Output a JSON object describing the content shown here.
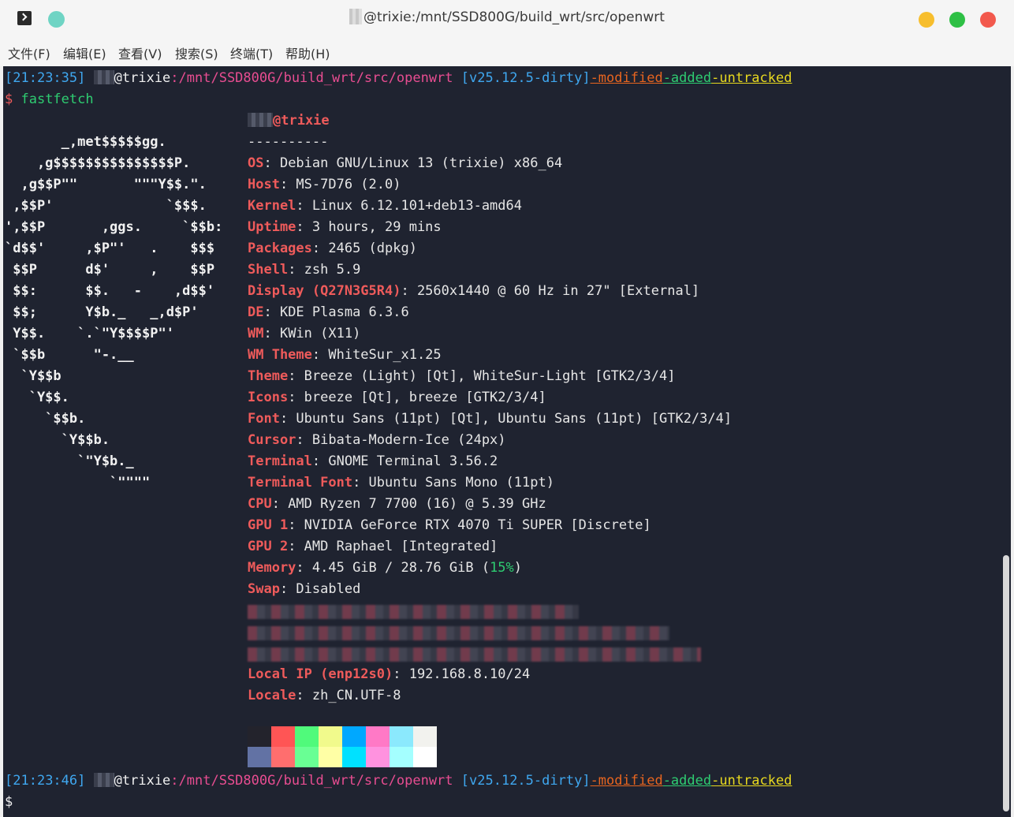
{
  "window": {
    "title": "@trixie:/mnt/SSD800G/build_wrt/src/openwrt"
  },
  "menu": {
    "items": [
      "文件(F)",
      "编辑(E)",
      "查看(V)",
      "搜索(S)",
      "终端(T)",
      "帮助(H)"
    ]
  },
  "prompt1": {
    "time": "21:23:35",
    "host": "@trixie",
    "path": ":/mnt/SSD800G/build_wrt/src/openwrt",
    "branch_open": " [",
    "version": "v25.12.5-dirty",
    "branch_close": "]",
    "modified": "-modified",
    "added": "-added",
    "untracked": "-untracked"
  },
  "command": {
    "symbol": "$",
    "text": " fastfetch"
  },
  "ascii": [
    "       _,met$$$$$gg.",
    "    ,g$$$$$$$$$$$$$$$P.",
    "  ,g$$P\"\"       \"\"\"Y$$.\".",
    " ,$$P'              `$$$.",
    "',$$P       ,ggs.     `$$b:",
    "`d$$'     ,$P\"'   .    $$$",
    " $$P      d$'     ,    $$P",
    " $$:      $$.   -    ,d$$'",
    " $$;      Y$b._   _,d$P'",
    " Y$$.    `.`\"Y$$$$P\"'",
    " `$$b      \"-.__",
    "  `Y$$b",
    "   `Y$$.",
    "     `$$b.",
    "       `Y$$b.",
    "         `\"Y$b._",
    "             `\"\"\"\""
  ],
  "info": {
    "user": "@trixie",
    "separator": "----------",
    "rows": [
      {
        "key": "OS",
        "value": ": Debian GNU/Linux 13 (trixie) x86_64"
      },
      {
        "key": "Host",
        "value": ": MS-7D76 (2.0)"
      },
      {
        "key": "Kernel",
        "value": ": Linux 6.12.101+deb13-amd64"
      },
      {
        "key": "Uptime",
        "value": ": 3 hours, 29 mins"
      },
      {
        "key": "Packages",
        "value": ": 2465 (dpkg)"
      },
      {
        "key": "Shell",
        "value": ": zsh 5.9"
      },
      {
        "key": "Display (Q27N3G5R4)",
        "value": ": 2560x1440 @ 60 Hz in 27\" [External]"
      },
      {
        "key": "DE",
        "value": ": KDE Plasma 6.3.6"
      },
      {
        "key": "WM",
        "value": ": KWin (X11)"
      },
      {
        "key": "WM Theme",
        "value": ": WhiteSur_x1.25"
      },
      {
        "key": "Theme",
        "value": ": Breeze (Light) [Qt], WhiteSur-Light [GTK2/3/4]"
      },
      {
        "key": "Icons",
        "value": ": breeze [Qt], breeze [GTK2/3/4]"
      },
      {
        "key": "Font",
        "value": ": Ubuntu Sans (11pt) [Qt], Ubuntu Sans (11pt) [GTK2/3/4]"
      },
      {
        "key": "Cursor",
        "value": ": Bibata-Modern-Ice (24px)"
      },
      {
        "key": "Terminal",
        "value": ": GNOME Terminal 3.56.2"
      },
      {
        "key": "Terminal Font",
        "value": ": Ubuntu Sans Mono (11pt)"
      },
      {
        "key": "CPU",
        "value": ": AMD Ryzen 7 7700 (16) @ 5.39 GHz"
      },
      {
        "key": "GPU 1",
        "value": ": NVIDIA GeForce RTX 4070 Ti SUPER [Discrete]"
      },
      {
        "key": "GPU 2",
        "value": ": AMD Raphael [Integrated]"
      }
    ],
    "memory": {
      "key": "Memory",
      "value_pre": ": 4.45 GiB / 28.76 GiB (",
      "percent": "15%",
      "value_post": ")"
    },
    "swap": {
      "key": "Swap",
      "value": ": Disabled"
    },
    "local_ip": {
      "key": "Local IP (enp12s0)",
      "value": ": 192.168.8.10/24"
    },
    "locale": {
      "key": "Locale",
      "value": ": zh_CN.UTF-8"
    }
  },
  "palette": {
    "top": [
      "#23232c",
      "#ff5555",
      "#50fa7b",
      "#f1fa8c",
      "#00a8ff",
      "#ff79c6",
      "#8be9fd",
      "#f2f2ee"
    ],
    "bottom": [
      "#6272a4",
      "#ff6e6e",
      "#69ff94",
      "#ffffa5",
      "#00e1ff",
      "#ff92df",
      "#a4ffff",
      "#ffffff"
    ]
  },
  "prompt2": {
    "time": "21:23:46",
    "host": "@trixie",
    "path": ":/mnt/SSD800G/build_wrt/src/openwrt",
    "branch_open": " [",
    "version": "v25.12.5-dirty",
    "branch_close": "]",
    "modified": "-modified",
    "added": "-added",
    "untracked": "-untracked"
  },
  "cursor_prompt": "$"
}
